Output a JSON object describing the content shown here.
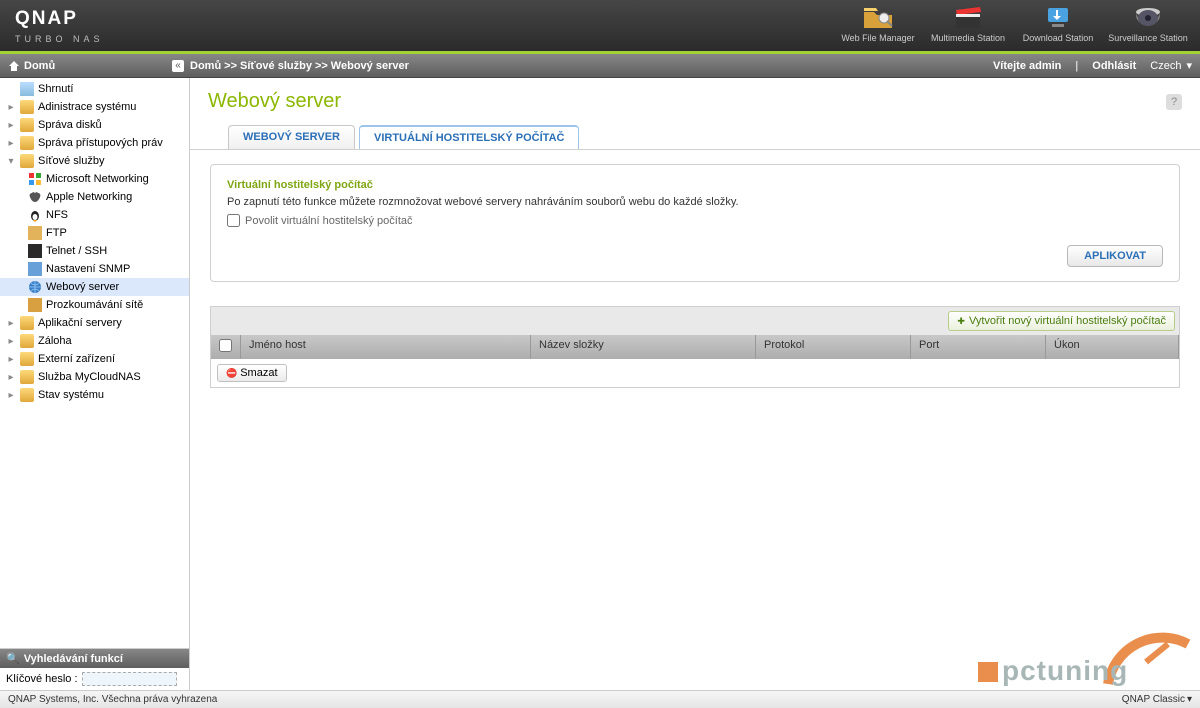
{
  "header": {
    "brand": "QNAP",
    "sub": "TURBO NAS",
    "apps": [
      {
        "label": "Web File Manager"
      },
      {
        "label": "Multimedia Station"
      },
      {
        "label": "Download Station"
      },
      {
        "label": "Surveillance Station"
      }
    ]
  },
  "crumb": {
    "home": "Domů",
    "path1": "Domů",
    "sep": ">>",
    "path2": "Síťové služby",
    "path3": "Webový server",
    "welcome": "Vítejte admin",
    "logout": "Odhlásit",
    "lang": "Czech"
  },
  "sidebar": {
    "items": [
      {
        "label": "Shrnutí",
        "icon": "list"
      },
      {
        "label": "Adinistrace systému",
        "icon": "folder",
        "expandable": true
      },
      {
        "label": "Správa disků",
        "icon": "folder",
        "expandable": true
      },
      {
        "label": "Správa přístupových práv",
        "icon": "folder",
        "expandable": true
      },
      {
        "label": "Síťové služby",
        "icon": "folder",
        "expandable": true,
        "expanded": true
      },
      {
        "label": "Microsoft Networking",
        "icon": "win",
        "child": true
      },
      {
        "label": "Apple Networking",
        "icon": "apple",
        "child": true
      },
      {
        "label": "NFS",
        "icon": "linux",
        "child": true
      },
      {
        "label": "FTP",
        "icon": "ftp",
        "child": true
      },
      {
        "label": "Telnet / SSH",
        "icon": "term",
        "child": true
      },
      {
        "label": "Nastavení SNMP",
        "icon": "snmp",
        "child": true
      },
      {
        "label": "Webový server",
        "icon": "globe",
        "child": true,
        "selected": true
      },
      {
        "label": "Prozkoumávání sítě",
        "icon": "scan",
        "child": true
      },
      {
        "label": "Aplikační servery",
        "icon": "folder",
        "expandable": true
      },
      {
        "label": "Záloha",
        "icon": "folder",
        "expandable": true
      },
      {
        "label": "Externí zařízení",
        "icon": "folder",
        "expandable": true
      },
      {
        "label": "Služba MyCloudNAS",
        "icon": "folder",
        "expandable": true
      },
      {
        "label": "Stav systému",
        "icon": "folder",
        "expandable": true
      }
    ],
    "search_title": "Vyhledávání funkcí",
    "search_label": "Klíčové heslo :"
  },
  "page": {
    "title": "Webový server",
    "tabs": [
      "WEBOVÝ SERVER",
      "VIRTUÁLNÍ HOSTITELSKÝ POČÍTAČ"
    ],
    "panel_title": "Virtuální hostitelský počítač",
    "panel_desc": "Po zapnutí této funkce můžete rozmnožovat webové servery nahráváním souborů webu do každé složky.",
    "checkbox_label": "Povolit virtuální hostitelský počítač",
    "apply_btn": "APLIKOVAT",
    "create_btn": "Vytvořit nový virtuální hostitelský počítač",
    "cols": {
      "host": "Jméno host",
      "folder": "Název složky",
      "proto": "Protokol",
      "port": "Port",
      "action": "Úkon"
    },
    "delete_btn": "Smazat"
  },
  "footer": {
    "copyright": "QNAP Systems, Inc. Všechna práva vyhrazena",
    "theme": "QNAP Classic"
  }
}
